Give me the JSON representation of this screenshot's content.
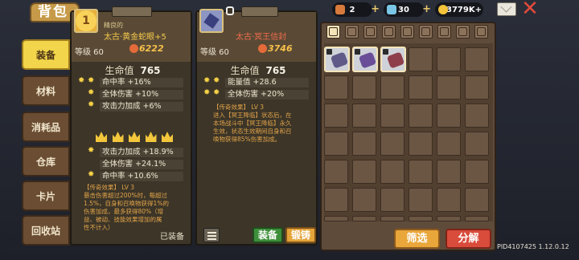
{
  "header": {
    "bag_title": "背包",
    "currency": [
      {
        "icon": "potion-icon",
        "value": "2",
        "color": "#d77a3b"
      },
      {
        "icon": "gem-icon",
        "value": "30",
        "color": "#7ac6e6"
      },
      {
        "icon": "coin-icon",
        "value": "3779K+",
        "color": "#f2c33b"
      }
    ],
    "mail_icon": "mail-icon",
    "close_icon": "close-icon"
  },
  "sidebar": {
    "tabs": [
      {
        "label": "装备",
        "active": true
      },
      {
        "label": "材料",
        "active": false
      },
      {
        "label": "消耗品",
        "active": false
      },
      {
        "label": "仓库",
        "active": false
      },
      {
        "label": "卡片",
        "active": false
      },
      {
        "label": "回收站",
        "active": false
      }
    ]
  },
  "card_equipped": {
    "portrait_number": "1",
    "rarity": "精良的",
    "name": "太古·黄金蛇眼+5",
    "level": "等级 60",
    "power": "6222",
    "hp_label": "生命值",
    "hp_value": "765",
    "stats_top": [
      "命中率 +16%",
      "全体伤害 +10%",
      "攻击力加成 +6%"
    ],
    "stats_bottom": [
      "攻击力加成 +18.9%",
      "全体伤害 +24.1%",
      "命中率 +10.6%"
    ],
    "crown_count": 5,
    "effect_title": "【传奇效果】 LV 3",
    "effect_lines": [
      "暴击伤害超过200%时，每超过",
      "1.5%，自身和召唤物获得1%的",
      "伤害加成，最多获得80%（增",
      "益、被动、技能效果增加的属",
      "性不计入）"
    ],
    "status": "已装备"
  },
  "card_new": {
    "name": "太古·冥王信封",
    "level": "等级 60",
    "power": "3746",
    "hp_label": "生命值",
    "hp_value": "765",
    "stats": [
      "能量值 +28.6",
      "全体伤害 +20%"
    ],
    "effect_title": "【传奇效果】 LV 3",
    "effect_lines": [
      "进入【冥王降临】状态后，在",
      "本场战斗中【冥王降临】永久",
      "生效，状态生效期间自身和召",
      "唤物获得85%伤害加成。"
    ],
    "equip_label": "装备",
    "forge_label": "锻铸"
  },
  "inventory": {
    "category_icons": [
      "grid-icon",
      "sword-icon",
      "bow-icon",
      "shield-icon",
      "armor-icon",
      "boot-icon",
      "ring-icon",
      "necklace-icon",
      "gear-icon"
    ]
  },
  "actions": {
    "filter_label": "筛选",
    "decompose_label": "分解"
  },
  "footer": {
    "pid": "PID4107425 1.12.0.12"
  }
}
